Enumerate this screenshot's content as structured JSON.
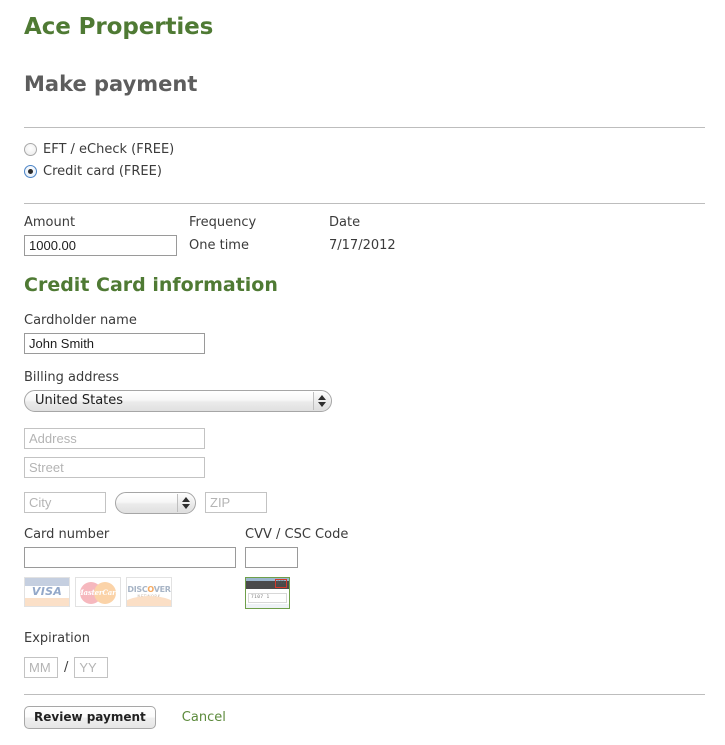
{
  "brand": "Ace Properties",
  "page_title": "Make payment",
  "colors": {
    "brand_green": "#4f7a34",
    "link_green": "#5c8a3c",
    "title_gray": "#5d5d5d",
    "rule_gray": "#bdbdbd",
    "cvv_border_green": "#6f9f4a",
    "cvv_highlight_red": "#d33a2c"
  },
  "payment_methods": {
    "options": [
      {
        "label": "EFT / eCheck (FREE)",
        "checked": false
      },
      {
        "label": "Credit card (FREE)",
        "checked": true
      }
    ]
  },
  "payment_summary": {
    "amount_label": "Amount",
    "amount_value": "1000.00",
    "frequency_label": "Frequency",
    "frequency_value": "One time",
    "date_label": "Date",
    "date_value": "7/17/2012"
  },
  "credit_card": {
    "section_title": "Credit Card information",
    "cardholder_label": "Cardholder name",
    "cardholder_value": "John Smith",
    "billing_label": "Billing address",
    "country_value": "United States",
    "address_placeholder": "Address",
    "street_placeholder": "Street",
    "city_placeholder": "City",
    "state_value": "",
    "zip_placeholder": "ZIP",
    "card_number_label": "Card number",
    "card_number_value": "",
    "cvv_label": "CVV / CSC Code",
    "cvv_value": "",
    "expiration_label": "Expiration",
    "month_placeholder": "MM",
    "year_placeholder": "YY",
    "date_separator": "/"
  },
  "card_logos": [
    {
      "name": "visa",
      "text": "VISA"
    },
    {
      "name": "mastercard",
      "text": "MasterCard"
    },
    {
      "name": "discover",
      "text_pre": "DISC",
      "text_o": "O",
      "text_post": "VER",
      "sub": "NETWORK"
    }
  ],
  "cvv_illustration": {
    "signature_digits": "7107 1",
    "cvv_digits": "032"
  },
  "footer": {
    "review_label": "Review payment",
    "cancel_label": "Cancel"
  }
}
